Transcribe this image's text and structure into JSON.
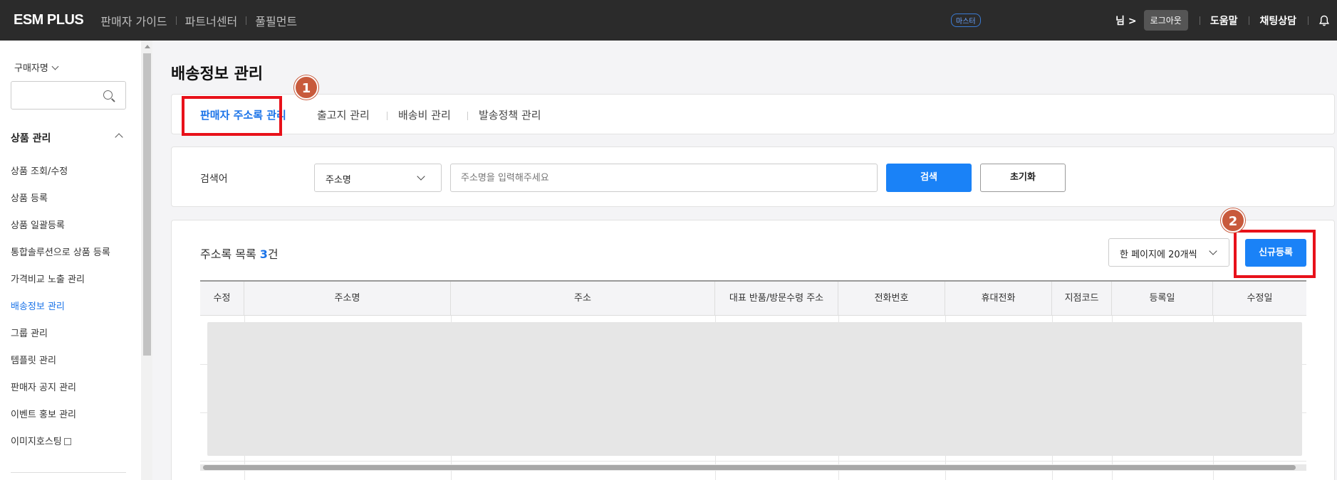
{
  "topbar": {
    "logo": "ESM PLUS",
    "nav": [
      "판매자 가이드",
      "파트너센터",
      "풀필먼트"
    ],
    "master_badge": "마스터",
    "user_suffix": "님 >",
    "logout": "로그아웃",
    "help": "도움말",
    "chat": "채팅상담"
  },
  "sidebar": {
    "buyer_select": "구매자명",
    "category": "상품 관리",
    "items": [
      {
        "label": "상품 조회/수정"
      },
      {
        "label": "상품 등록"
      },
      {
        "label": "상품 일괄등록"
      },
      {
        "label": "통합솔루션으로 상품 등록"
      },
      {
        "label": "가격비교 노출 관리"
      },
      {
        "label": "배송정보 관리",
        "active": true
      },
      {
        "label": "그룹 관리"
      },
      {
        "label": "템플릿 관리"
      },
      {
        "label": "판매자 공지 관리"
      },
      {
        "label": "이벤트 홍보 관리"
      },
      {
        "label": "이미지호스팅",
        "external": true
      }
    ]
  },
  "page": {
    "title": "배송정보 관리",
    "tabs": [
      "판매자 주소록 관리",
      "출고지 관리",
      "배송비 관리",
      "발송정책 관리"
    ]
  },
  "search": {
    "label": "검색어",
    "select_value": "주소명",
    "input_placeholder": "주소명을 입력해주세요",
    "search_button": "검색",
    "reset_button": "초기화"
  },
  "list": {
    "title": "주소록 목록",
    "count": "3",
    "count_suffix": "건",
    "per_page": "한 페이지에 20개씩",
    "new_button": "신규등록",
    "columns": [
      "수정",
      "주소명",
      "주소",
      "대표 반품/방문수령 주소",
      "전화번호",
      "휴대전화",
      "지점코드",
      "등록일",
      "수정일"
    ]
  },
  "annotations": {
    "marker1": "1",
    "marker2": "2",
    "highlight_color": "#e8111a"
  },
  "colors": {
    "accent": "#1a82f7",
    "topbar": "#2b2b2b"
  }
}
